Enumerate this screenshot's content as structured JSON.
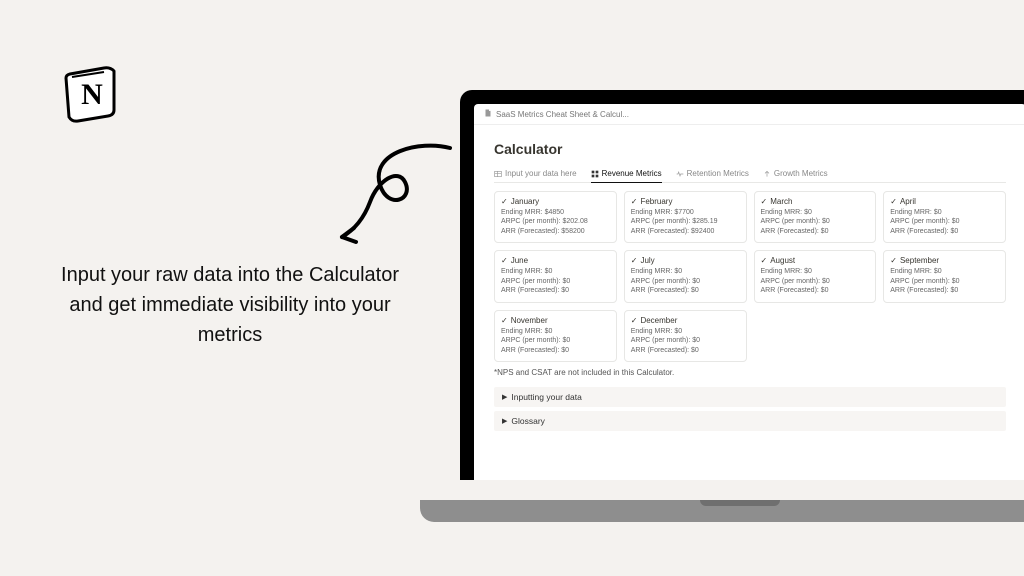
{
  "marketing": {
    "caption": "Input your raw data into the Calculator and get immediate visibility into your metrics"
  },
  "breadcrumb": {
    "title": "SaaS Metrics Cheat Sheet & Calcul..."
  },
  "page_title": "Calculator",
  "tabs": [
    {
      "id": "input",
      "label": "Input your data here"
    },
    {
      "id": "revenue",
      "label": "Revenue Metrics"
    },
    {
      "id": "retention",
      "label": "Retention Metrics"
    },
    {
      "id": "growth",
      "label": "Growth Metrics"
    }
  ],
  "active_tab": "revenue",
  "cards": [
    {
      "month": "January",
      "lines": [
        "Ending MRR: $4850",
        "ARPC (per month): $202.08",
        "ARR (Forecasted): $58200"
      ]
    },
    {
      "month": "February",
      "lines": [
        "Ending MRR: $7700",
        "ARPC (per month): $285.19",
        "ARR (Forecasted): $92400"
      ]
    },
    {
      "month": "March",
      "lines": [
        "Ending MRR: $0",
        "ARPC (per month): $0",
        "ARR (Forecasted): $0"
      ]
    },
    {
      "month": "April",
      "lines": [
        "Ending MRR: $0",
        "ARPC (per month): $0",
        "ARR (Forecasted): $0"
      ]
    },
    {
      "month": "June",
      "lines": [
        "Ending MRR: $0",
        "ARPC (per month): $0",
        "ARR (Forecasted): $0"
      ]
    },
    {
      "month": "July",
      "lines": [
        "Ending MRR: $0",
        "ARPC (per month): $0",
        "ARR (Forecasted): $0"
      ]
    },
    {
      "month": "August",
      "lines": [
        "Ending MRR: $0",
        "ARPC (per month): $0",
        "ARR (Forecasted): $0"
      ]
    },
    {
      "month": "September",
      "lines": [
        "Ending MRR: $0",
        "ARPC (per month): $0",
        "ARR (Forecasted): $0"
      ]
    },
    {
      "month": "November",
      "lines": [
        "Ending MRR: $0",
        "ARPC (per month): $0",
        "ARR (Forecasted): $0"
      ]
    },
    {
      "month": "December",
      "lines": [
        "Ending MRR: $0",
        "ARPC (per month): $0",
        "ARR (Forecasted): $0"
      ]
    }
  ],
  "footnote": "*NPS and CSAT are not included in this Calculator.",
  "toggles": [
    "Inputting your data",
    "Glossary"
  ],
  "colors": {
    "bg": "#f4f2ef",
    "text": "#37352f"
  }
}
